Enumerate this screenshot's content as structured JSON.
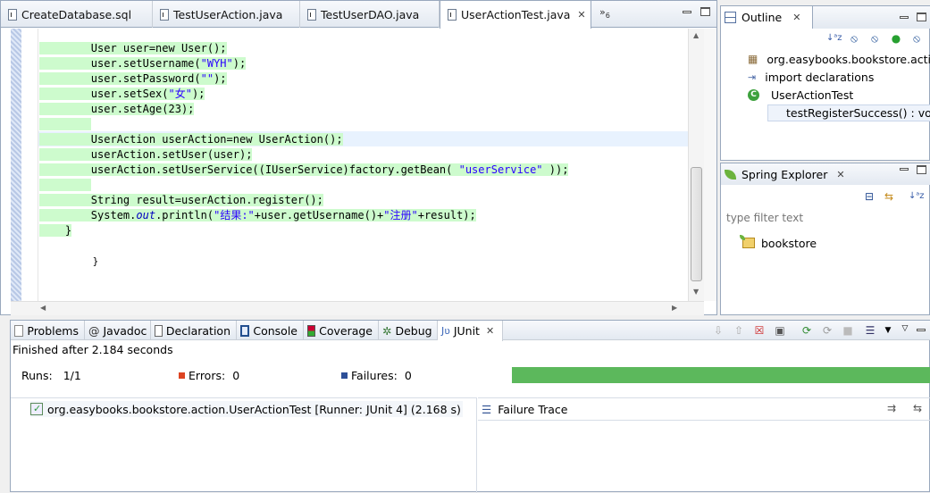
{
  "editor": {
    "tabs": [
      {
        "label": "CreateDatabase.sql"
      },
      {
        "label": "TestUserAction.java"
      },
      {
        "label": "TestUserDAO.java"
      },
      {
        "label": "UserActionTest.java"
      }
    ],
    "overflow_count": "6",
    "lines": {
      "l1": "User user=new User();",
      "l2a": "user.setUsername(",
      "l2s": "\"WYH\"",
      "l2b": ");",
      "l3a": "user.setPassword(",
      "l3s": "\"\"",
      "l3b": ");",
      "l4a": "user.setSex(",
      "l4s": "\"女\"",
      "l4b": ");",
      "l5": "user.setAge(23);",
      "l6": "UserAction userAction=new UserAction();",
      "l7": "userAction.setUser(user);",
      "l8a": "userAction.setUserService((IUserService)factory.getBean( ",
      "l8s": "\"userService\"",
      "l8b": " ));",
      "l9": "String result=userAction.register();",
      "l10a": "System.",
      "l10f": "out",
      "l10b": ".println(",
      "l10s1": "\"结果:\"",
      "l10c": "+user.getUsername()+",
      "l10s2": "\"注册\"",
      "l10d": "+result);",
      "l11": "}",
      "l12": "}"
    }
  },
  "outline": {
    "title": "Outline",
    "items": [
      {
        "label": "org.easybooks.bookstore.actio"
      },
      {
        "label": "import declarations"
      },
      {
        "label": "UserActionTest"
      },
      {
        "label": "testRegisterSuccess() : void"
      }
    ]
  },
  "spring": {
    "title": "Spring Explorer",
    "filter_placeholder": "type filter text",
    "project": "bookstore"
  },
  "bottom": {
    "tabs": [
      {
        "label": "Problems"
      },
      {
        "label": "Javadoc"
      },
      {
        "label": "Declaration"
      },
      {
        "label": "Console"
      },
      {
        "label": "Coverage"
      },
      {
        "label": "Debug"
      },
      {
        "label": "JUnit"
      }
    ],
    "status": "Finished after 2.184 seconds",
    "runs_label": "Runs:",
    "runs_value": "1/1",
    "errors_label": "Errors:",
    "errors_value": "0",
    "failures_label": "Failures:",
    "failures_value": "0",
    "progress": 1.0,
    "progress_color": "#5cb85c",
    "test_item": "org.easybooks.bookstore.action.UserActionTest [Runner: JUnit 4] (2.168 s)",
    "failure_trace": "Failure Trace"
  }
}
